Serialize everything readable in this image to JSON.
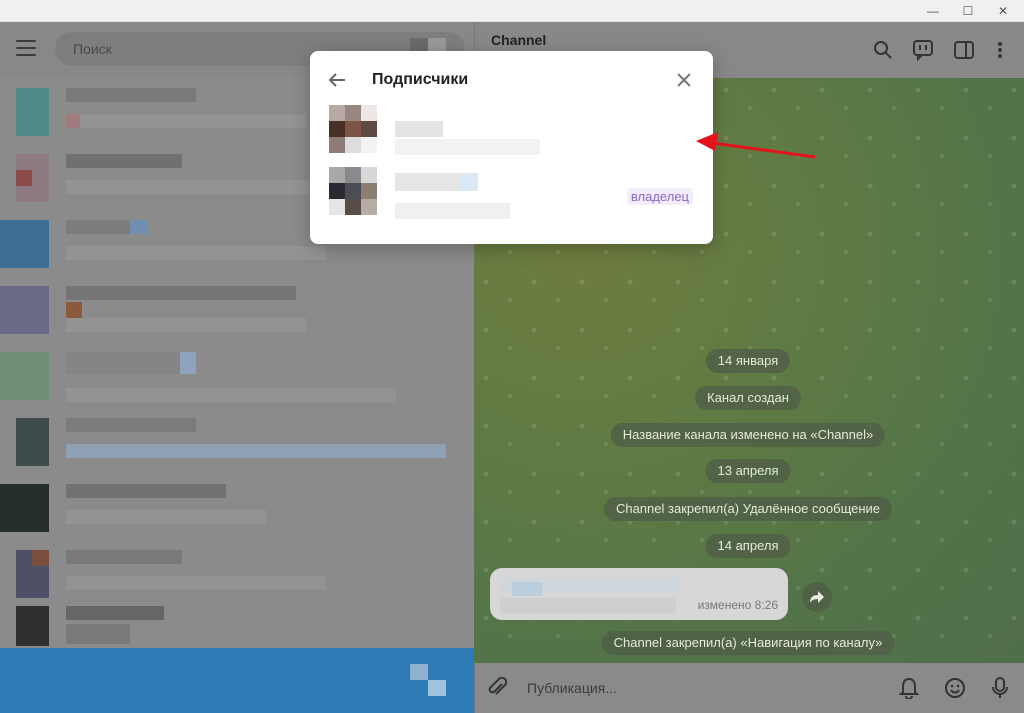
{
  "window": {
    "minimize": "—",
    "maximize": "☐",
    "close": "✕"
  },
  "sidebar": {
    "search_placeholder": "Поиск"
  },
  "chat": {
    "title": "Channel",
    "services": [
      {
        "text": "14 января"
      },
      {
        "text": "Канал создан"
      },
      {
        "text": "Название канала изменено на «Channel»"
      },
      {
        "text": "13 апреля"
      },
      {
        "text": "Channel закрепил(а) Удалённое сообщение"
      },
      {
        "text": "14 апреля"
      },
      {
        "text": "Channel закрепил(а) «Навигация по каналу»"
      }
    ],
    "message": {
      "edited": "изменено 8:26"
    },
    "input_placeholder": "Публикация..."
  },
  "modal": {
    "title": "Подписчики",
    "members": [
      {
        "role": ""
      },
      {
        "role": "владелец"
      }
    ]
  },
  "colors": {
    "accent": "#2e7ab4",
    "badge": "#8b6ac6",
    "arrow": "#e3131b"
  },
  "icons": [
    "hamburger-icon",
    "search-icon",
    "comments-icon",
    "sidebar-toggle-icon",
    "more-icon",
    "attach-icon",
    "bell-icon",
    "emoji-icon",
    "mic-icon",
    "back-arrow-icon",
    "close-icon",
    "forward-icon"
  ]
}
